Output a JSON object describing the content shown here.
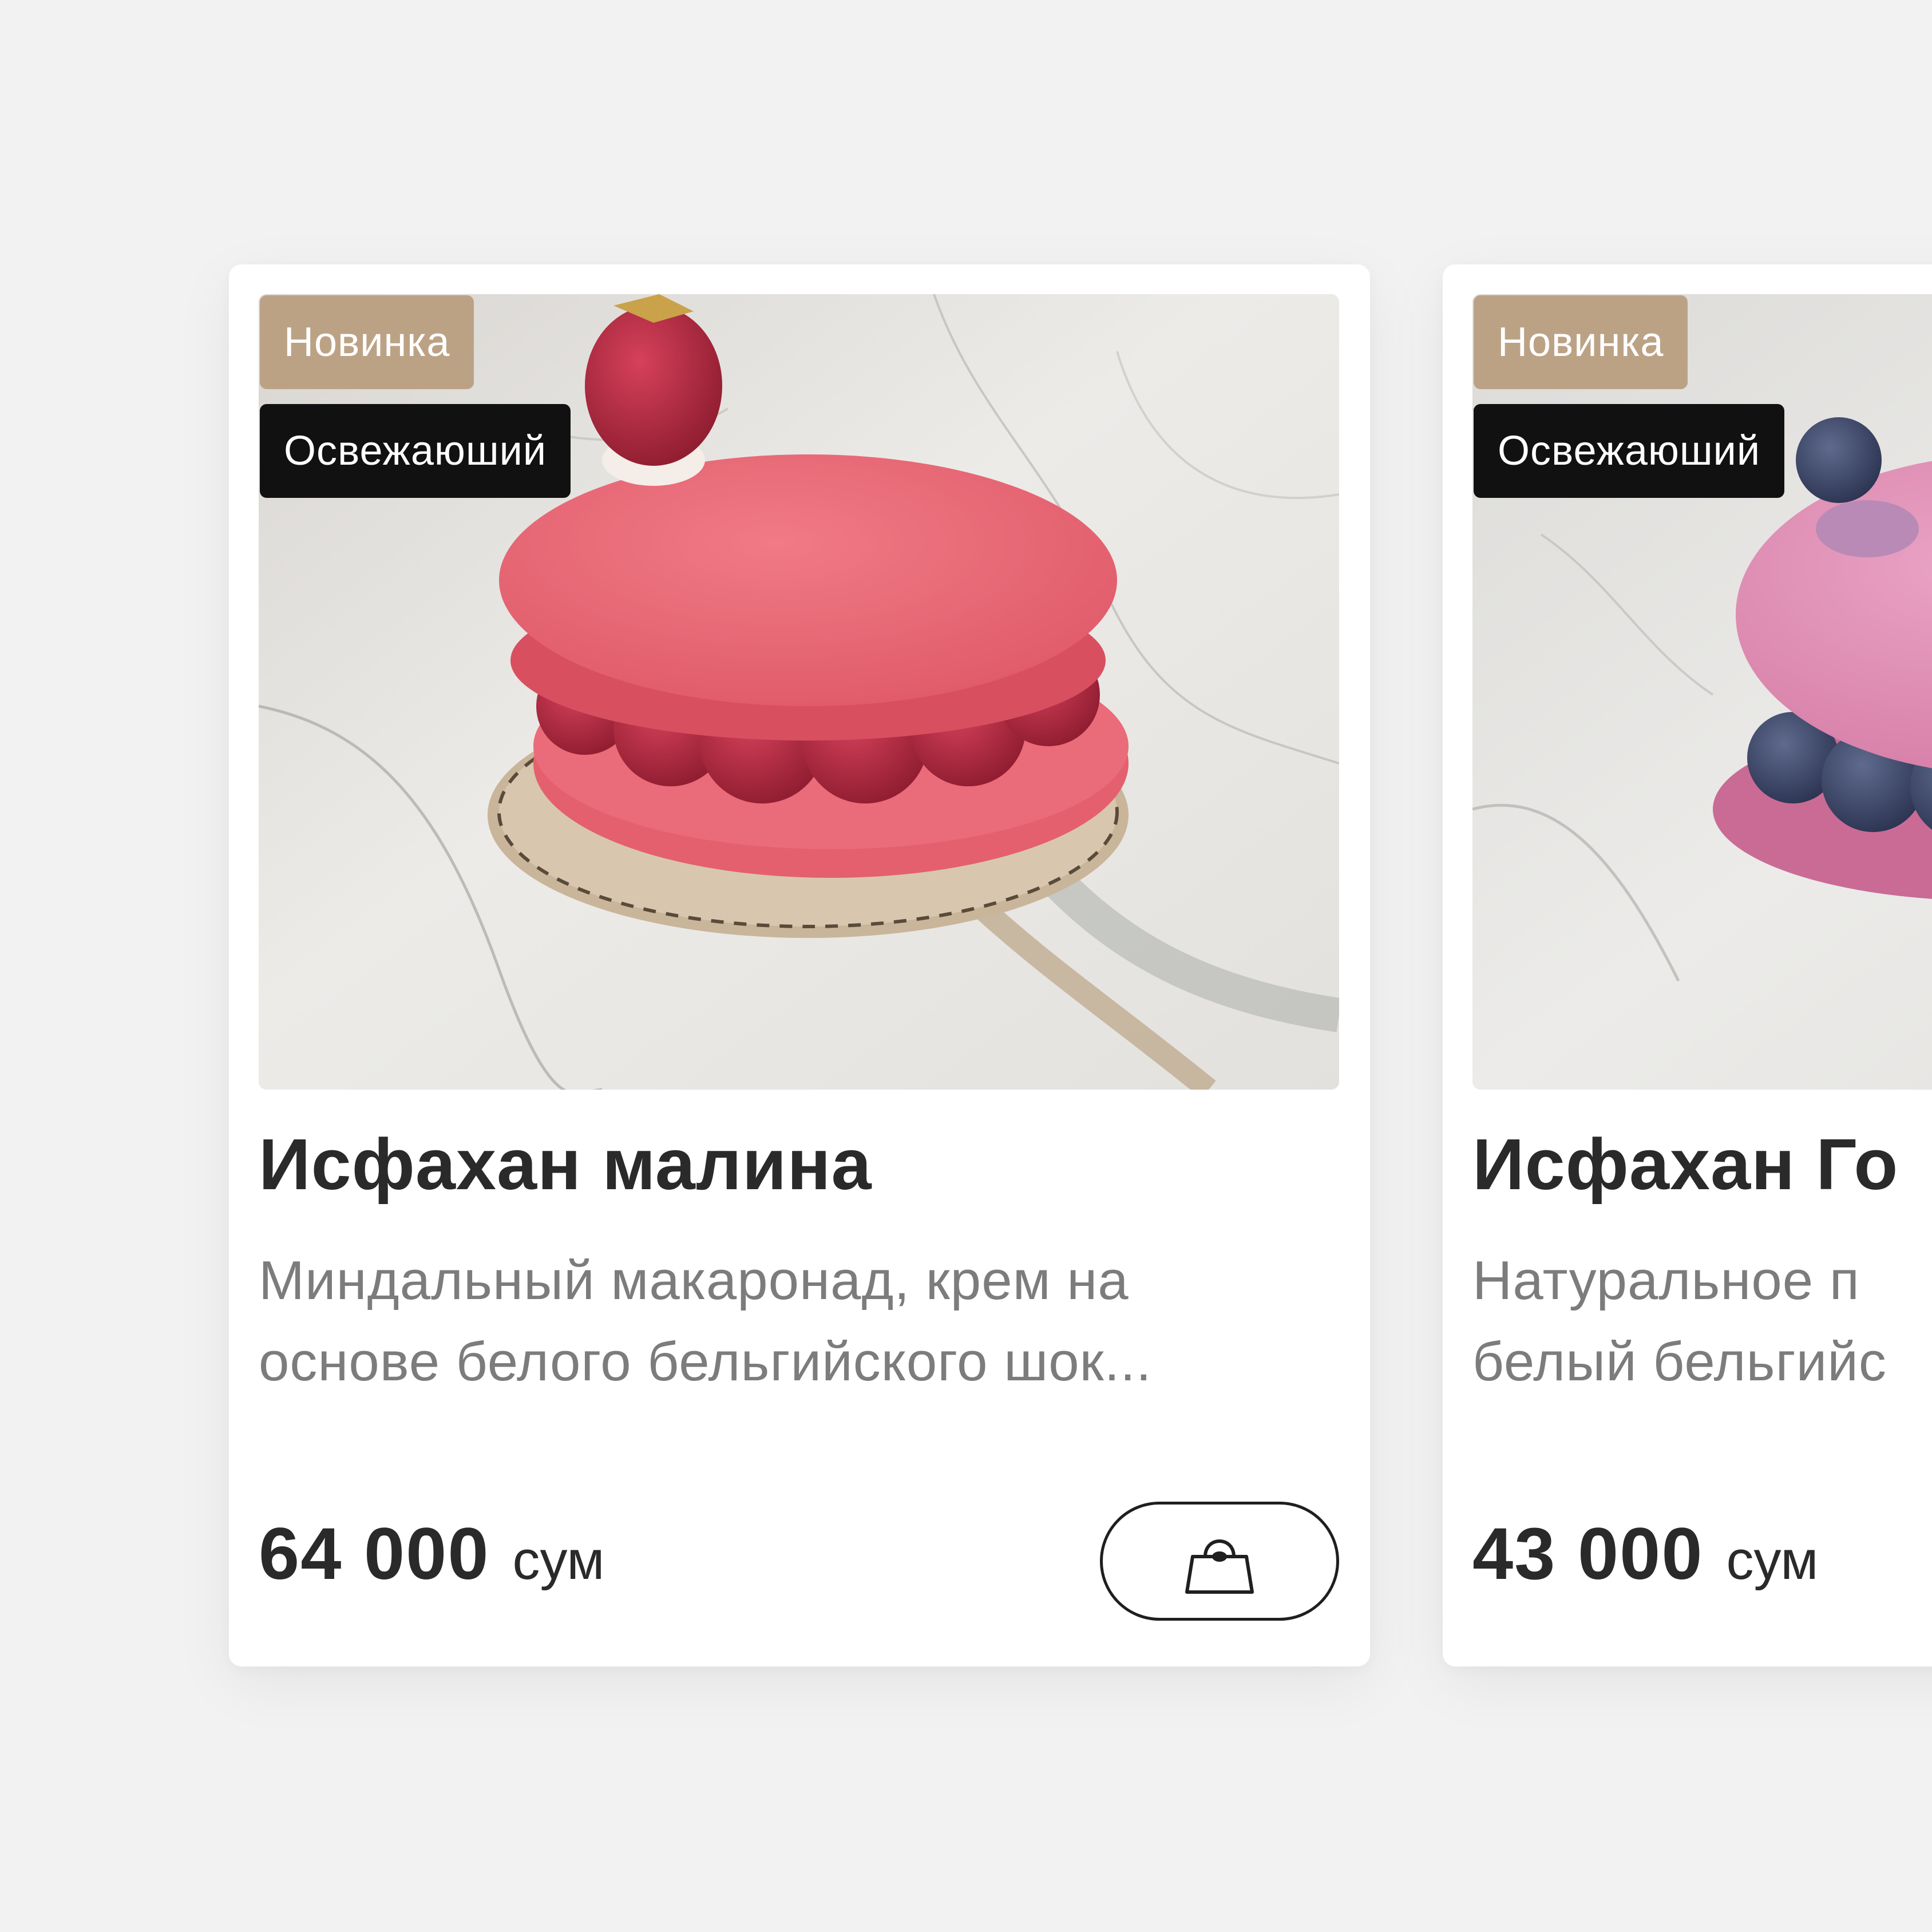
{
  "products": [
    {
      "badge_new": "Новинка",
      "badge_tag": "Освежаюший",
      "title": "Исфахан малина",
      "description_line1": "Миндальный макаронад, крем на",
      "description_line2": "основе белого бельгийского шок...",
      "price": "64 000",
      "currency": "сум",
      "image_subject": "raspberry macaron dessert on marble"
    },
    {
      "badge_new": "Новинка",
      "badge_tag": "Освежаюший",
      "title": "Исфахан Го",
      "description_line1": "Натуральное п",
      "description_line2": "белый бельгийс",
      "price": "43 000",
      "currency": "сум",
      "image_subject": "blueberry macaron dessert on marble"
    }
  ],
  "icons": {
    "cart": "shopping-bag-icon"
  },
  "colors": {
    "page_background": "#f2f2f2",
    "card_background": "#ffffff",
    "badge_new": "#bca285",
    "badge_tag": "#111111",
    "title_text": "#2a2a2a",
    "description_text": "#7c7c7c"
  }
}
